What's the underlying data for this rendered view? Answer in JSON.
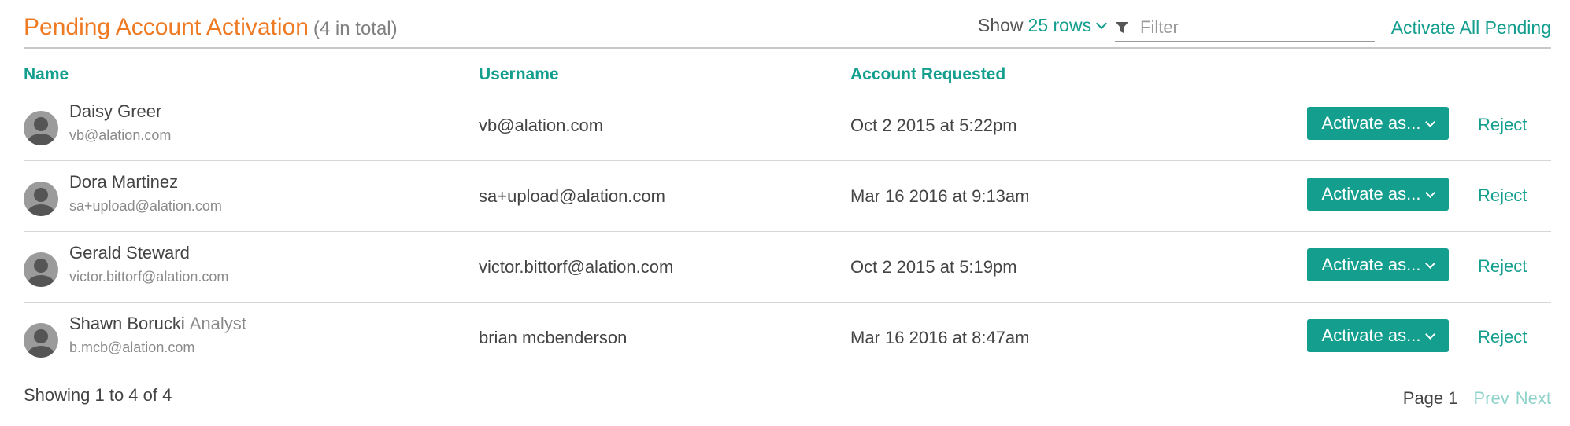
{
  "header": {
    "title": "Pending Account Activation",
    "total": "(4 in total)",
    "show_label": "Show",
    "rows_option": "25 rows",
    "filter_placeholder": "Filter",
    "activate_all": "Activate All Pending"
  },
  "columns": {
    "name": "Name",
    "username": "Username",
    "requested": "Account Requested"
  },
  "rows": [
    {
      "name": "Daisy Greer",
      "role": "",
      "email": "vb@alation.com",
      "username": "vb@alation.com",
      "requested": "Oct 2 2015 at 5:22pm",
      "activate": "Activate as...",
      "reject": "Reject"
    },
    {
      "name": "Dora Martinez",
      "role": "",
      "email": "sa+upload@alation.com",
      "username": "sa+upload@alation.com",
      "requested": "Mar 16 2016 at 9:13am",
      "activate": "Activate as...",
      "reject": "Reject"
    },
    {
      "name": "Gerald Steward",
      "role": "",
      "email": "victor.bittorf@alation.com",
      "username": "victor.bittorf@alation.com",
      "requested": "Oct 2 2015 at 5:19pm",
      "activate": "Activate as...",
      "reject": "Reject"
    },
    {
      "name": "Shawn Borucki",
      "role": "Analyst",
      "email": "b.mcb@alation.com",
      "username": "brian mcbenderson",
      "requested": "Mar 16 2016 at 8:47am",
      "activate": "Activate as...",
      "reject": "Reject"
    }
  ],
  "footer": {
    "showing": "Showing 1 to 4 of 4",
    "page": "Page 1",
    "prev": "Prev",
    "next": "Next"
  },
  "colors": {
    "accent": "#139e8e",
    "title": "#ee7a23",
    "disabled_link": "#8fd3cb"
  }
}
